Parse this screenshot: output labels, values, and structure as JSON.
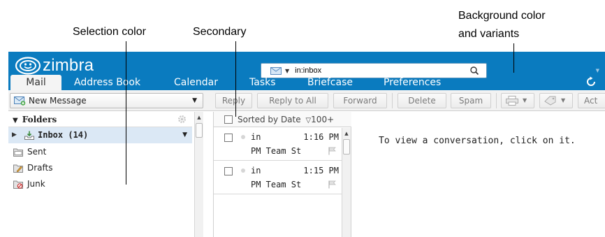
{
  "annotations": {
    "background": {
      "line1": "Background color",
      "line2": "and variants"
    },
    "selection": "Selection color",
    "secondary": "Secondary"
  },
  "app": {
    "logo_text": "zimbra",
    "search": {
      "value": "in:inbox"
    },
    "tabs": [
      {
        "label": "Mail",
        "active": true
      },
      {
        "label": "Address Book"
      },
      {
        "label": "Calendar"
      },
      {
        "label": "Tasks"
      },
      {
        "label": "Briefcase"
      },
      {
        "label": "Preferences"
      }
    ],
    "toolbar": {
      "new_message": "New Message",
      "reply": "Reply",
      "reply_all": "Reply to All",
      "forward": "Forward",
      "delete": "Delete",
      "spam": "Spam",
      "actions": "Act"
    },
    "folders": {
      "header": "Folders",
      "items": [
        {
          "label": "Inbox (14)",
          "selected": true
        },
        {
          "label": "Sent"
        },
        {
          "label": "Drafts"
        },
        {
          "label": "Junk"
        }
      ]
    },
    "list": {
      "sort_label": "Sorted by Date",
      "count": "100+",
      "messages": [
        {
          "folder": "in",
          "time": "1:16 PM",
          "subject": "PM Team St"
        },
        {
          "folder": "in",
          "time": "1:15 PM",
          "subject": "PM Team St"
        }
      ]
    },
    "reading_pane": {
      "message": "To view a conversation, click on it."
    }
  },
  "colors": {
    "background": "#0a7bbf",
    "selection": "#dbe8f5",
    "secondary": "#0a6aa4"
  }
}
